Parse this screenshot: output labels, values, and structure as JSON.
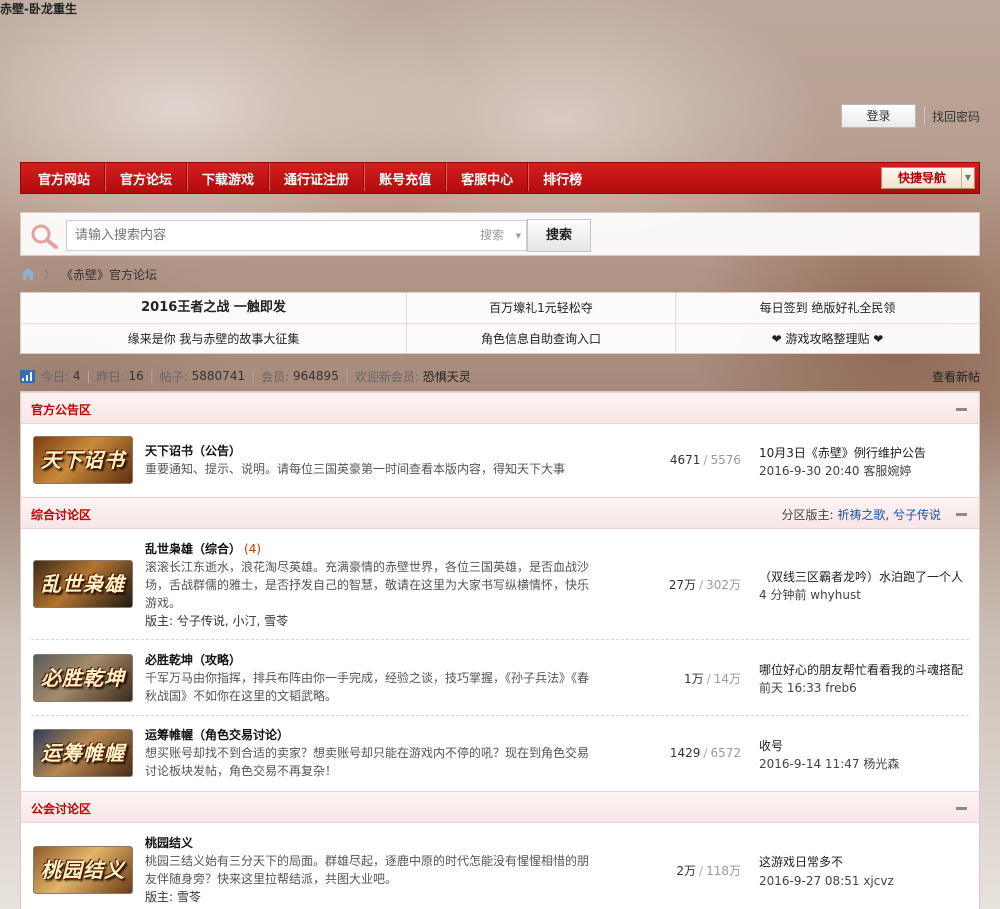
{
  "site": {
    "title": "赤壁-卧龙重生"
  },
  "header": {
    "login_label": "登录",
    "find_password": "找回密码"
  },
  "nav": {
    "items": [
      "官方网站",
      "官方论坛",
      "下载游戏",
      "通行证注册",
      "账号充值",
      "客服中心",
      "排行榜"
    ],
    "quick_nav": "快捷导航"
  },
  "search": {
    "placeholder": "请输入搜索内容",
    "type_label": "搜索",
    "button": "搜索"
  },
  "breadcrumb": {
    "current": "《赤壁》官方论坛"
  },
  "promo": {
    "row1": [
      "2016王者之战 一触即发",
      "百万壕礼1元轻松夺",
      "每日签到 绝版好礼全民领"
    ],
    "row2": [
      "缘来是你 我与赤壁的故事大征集",
      "角色信息自助查询入口",
      "❤ 游戏攻略整理贴 ❤"
    ]
  },
  "stats": {
    "today_label": "今日:",
    "today": "4",
    "yesterday_label": "昨日:",
    "yesterday": "16",
    "posts_label": "帖子:",
    "posts": "5880741",
    "members_label": "会员:",
    "members": "964895",
    "welcome_label": "欢迎新会员:",
    "new_member": "恐惧天灵",
    "view_new": "查看新帖"
  },
  "categories": [
    {
      "title": "官方公告区",
      "moderators_label": "",
      "moderators": [],
      "forums": [
        {
          "name": "天下诏书（公告）",
          "today": "",
          "desc": "重要通知、提示、说明。请每位三国英豪第一时间查看本版内容，得知天下大事",
          "mods_label": "",
          "threads": "4671",
          "posts": "5576",
          "last_title": "10月3日《赤壁》例行维护公告",
          "last_meta": "2016-9-30 20:40 客服婉婷",
          "thumb": "天下诏书"
        }
      ]
    },
    {
      "title": "综合讨论区",
      "moderators_label": "分区版主:",
      "moderators": [
        "祈祷之歌",
        "兮子传说"
      ],
      "forums": [
        {
          "name": "乱世枭雄（综合）",
          "today": "(4)",
          "desc": "滚滚长江东逝水，浪花淘尽英雄。充满豪情的赤壁世界，各位三国英雄，是否血战沙场，舌战群儒的雅士，是否抒发自己的智慧，敬请在这里为大家书写纵横情怀，快乐游戏。",
          "mods_label": "版主: 兮子传说, 小汀, 雪苓",
          "threads": "27万",
          "posts": "302万",
          "last_title": "（双线三区霸者龙吟）水泊跑了一个人",
          "last_meta": "4 分钟前 whyhust",
          "thumb": "乱世枭雄"
        },
        {
          "name": "必胜乾坤（攻略）",
          "today": "",
          "desc": "千军万马由你指挥，排兵布阵由你一手完成，经验之谈，技巧掌握，《孙子兵法》《春秋战国》不如你在这里的文韬武略。",
          "mods_label": "",
          "threads": "1万",
          "posts": "14万",
          "last_title": "哪位好心的朋友帮忙看看我的斗魂搭配",
          "last_meta": "前天 16:33 freb6",
          "thumb": "必胜乾坤"
        },
        {
          "name": "运筹帷幄（角色交易讨论）",
          "today": "",
          "desc": "想买账号却找不到合适的卖家？想卖账号却只能在游戏内不停的吼？现在到角色交易讨论板块发帖，角色交易不再复杂！",
          "mods_label": "",
          "threads": "1429",
          "posts": "6572",
          "last_title": "收号",
          "last_meta": "2016-9-14 11:47 杨光森",
          "thumb": "运筹帷幄"
        }
      ]
    },
    {
      "title": "公会讨论区",
      "moderators_label": "",
      "moderators": [],
      "forums": [
        {
          "name": "桃园结义",
          "today": "",
          "desc": "桃园三结义始有三分天下的局面。群雄尽起，逐鹿中原的时代怎能没有惺惺相惜的朋友伴随身旁？快来这里拉帮结派，共图大业吧。",
          "mods_label": "版主: 雪苓",
          "threads": "2万",
          "posts": "118万",
          "last_title": "这游戏日常多不",
          "last_meta": "2016-9-27 08:51 xjcvz",
          "thumb": "桃园结义"
        }
      ]
    }
  ],
  "colors": {
    "nav_red": "#c51414",
    "category_title": "#c00000",
    "moderator_link": "#1f4fa0"
  }
}
